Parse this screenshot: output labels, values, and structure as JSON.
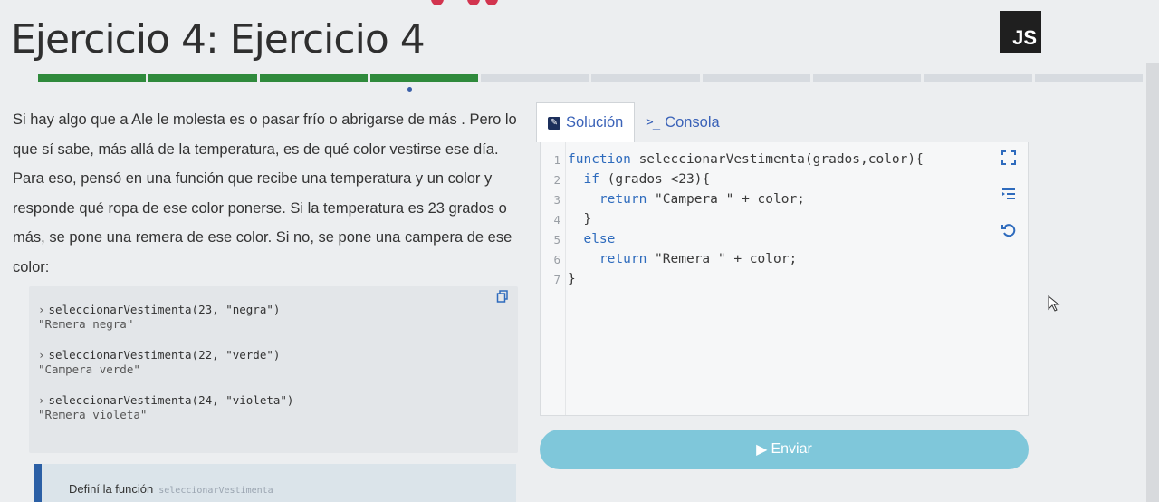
{
  "exercise": {
    "title": "Ejercicio 4: Ejercicio 4",
    "language_badge": "JS",
    "progress": {
      "completed_segments": 4,
      "total_segments": 10
    }
  },
  "description": {
    "paragraph": "Si hay algo que a Ale le molesta es o pasar frío o abrigarse de más . Pero lo que sí sabe, más allá de la temperatura, es de qué color vestirse ese día. Para eso, pensó en una función que recibe una temperatura y un color y responde qué ropa de ese color ponerse. Si la temperatura es 23 grados o más, se pone una remera de ese color. Si no, se pone una campera de ese color:"
  },
  "examples": [
    {
      "call": "seleccionarVestimenta(23, \"negra\")",
      "result": "\"Remera negra\""
    },
    {
      "call": "seleccionarVestimenta(22, \"verde\")",
      "result": "\"Campera verde\""
    },
    {
      "call": "seleccionarVestimenta(24, \"violeta\")",
      "result": "\"Remera violeta\""
    }
  ],
  "task": {
    "text": "Definí la función",
    "code": "seleccionarVestimenta"
  },
  "tabs": [
    {
      "label": "Solución",
      "icon": "pencil-icon",
      "active": true
    },
    {
      "label": "Consola",
      "icon": "terminal-icon",
      "active": false
    }
  ],
  "editor": {
    "lines": [
      {
        "num": "1",
        "text": "function seleccionarVestimenta(grados,color){"
      },
      {
        "num": "2",
        "text": "  if (grados <23){"
      },
      {
        "num": "3",
        "text": "    return \"Campera \" + color;"
      },
      {
        "num": "4",
        "text": "  }"
      },
      {
        "num": "5",
        "text": "  else"
      },
      {
        "num": "6",
        "text": "    return \"Remera \" + color;"
      },
      {
        "num": "7",
        "text": "}"
      }
    ],
    "tools": [
      "fullscreen-icon",
      "indent-icon",
      "reset-icon"
    ]
  },
  "submit": {
    "label": "Enviar",
    "icon": "play-icon"
  },
  "colors": {
    "accent": "#3a62b8",
    "progress_done": "#2f8a3c",
    "submit_bg": "#7fc7da",
    "task_border": "#2b5fa5"
  }
}
